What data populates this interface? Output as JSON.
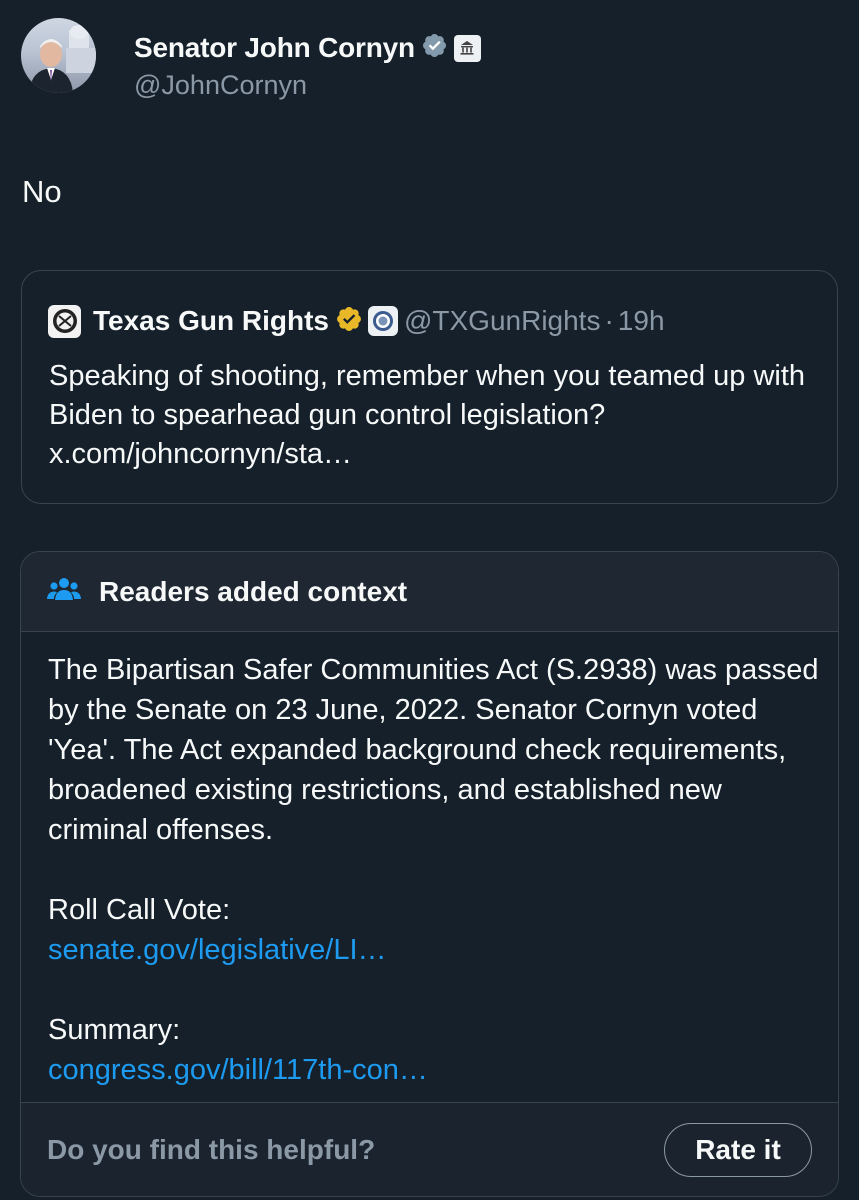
{
  "author": {
    "display_name": "Senator John Cornyn",
    "handle": "@JohnCornyn",
    "verified_icon": "verified-badge-icon",
    "affiliation_icon": "government-building-icon"
  },
  "tweet": {
    "text": "No"
  },
  "quoted_tweet": {
    "display_name": "Texas Gun Rights",
    "handle": "@TXGunRights",
    "separator": "·",
    "time": "19h",
    "text": "Speaking of shooting, remember when you teamed up with Biden to spearhead gun control legislation? x.com/johncornyn/sta…",
    "verified_icon": "gold-verified-badge-icon",
    "affiliation_icon": "organization-seal-icon"
  },
  "note": {
    "title": "Readers added context",
    "body": "The Bipartisan Safer Communities Act (S.2938) was passed by the Senate on 23 June, 2022. Senator Cornyn voted 'Yea'. The Act expanded background check requirements, broadened existing restrictions, and established new criminal offenses.",
    "roll_call_label": "Roll Call Vote:",
    "roll_call_link": "senate.gov/legislative/LI…",
    "summary_label": "Summary:",
    "summary_link": "congress.gov/bill/117th-con…",
    "helpful_prompt": "Do you find this helpful?",
    "rate_button": "Rate it"
  },
  "colors": {
    "background": "#15202b",
    "border": "#38444d",
    "text_primary": "#f7f9f9",
    "text_secondary": "#8b98a5",
    "link": "#1d9bf0",
    "gold_badge": "#e8b829"
  }
}
